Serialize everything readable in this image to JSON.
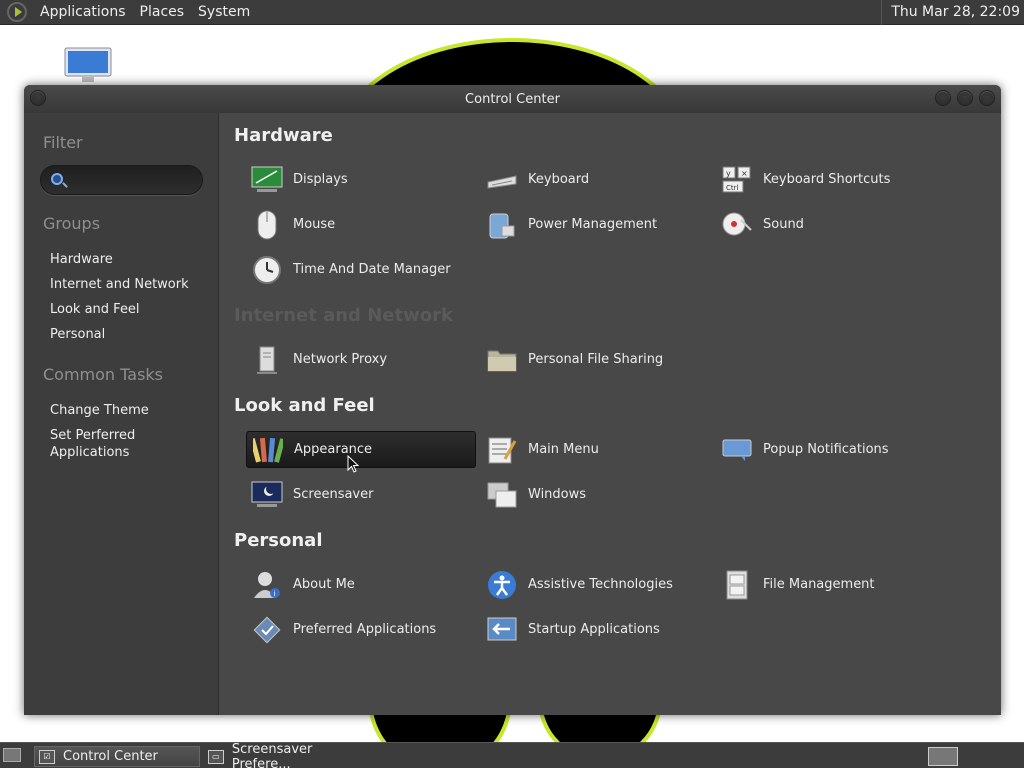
{
  "top_panel": {
    "menus": [
      "Applications",
      "Places",
      "System"
    ],
    "clock": "Thu Mar 28, 22:09"
  },
  "window": {
    "title": "Control Center"
  },
  "sidebar": {
    "filter_heading": "Filter",
    "search_placeholder": "",
    "groups_heading": "Groups",
    "groups": [
      "Hardware",
      "Internet and Network",
      "Look and Feel",
      "Personal"
    ],
    "tasks_heading": "Common Tasks",
    "tasks": [
      "Change Theme",
      "Set Perferred Applications"
    ]
  },
  "sections": [
    {
      "title": "Hardware",
      "items": [
        {
          "label": "Displays",
          "icon": "display-icon"
        },
        {
          "label": "Keyboard",
          "icon": "keyboard-icon"
        },
        {
          "label": "Keyboard Shortcuts",
          "icon": "keyboard-shortcuts-icon"
        },
        {
          "label": "Mouse",
          "icon": "mouse-icon"
        },
        {
          "label": "Power Management",
          "icon": "power-management-icon"
        },
        {
          "label": "Sound",
          "icon": "sound-icon"
        },
        {
          "label": "Time And Date Manager",
          "icon": "clock-icon"
        }
      ]
    },
    {
      "title": "Internet and Network",
      "items": [
        {
          "label": "Network Proxy",
          "icon": "network-proxy-icon"
        },
        {
          "label": "Personal File Sharing",
          "icon": "folder-share-icon"
        }
      ]
    },
    {
      "title": "Look and Feel",
      "items": [
        {
          "label": "Appearance",
          "icon": "appearance-icon",
          "selected": true
        },
        {
          "label": "Main Menu",
          "icon": "main-menu-icon"
        },
        {
          "label": "Popup Notifications",
          "icon": "notification-icon"
        },
        {
          "label": "Screensaver",
          "icon": "screensaver-icon"
        },
        {
          "label": "Windows",
          "icon": "windows-icon"
        }
      ]
    },
    {
      "title": "Personal",
      "items": [
        {
          "label": "About Me",
          "icon": "user-icon"
        },
        {
          "label": "Assistive Technologies",
          "icon": "accessibility-icon"
        },
        {
          "label": "File Management",
          "icon": "file-cabinet-icon"
        },
        {
          "label": "Preferred Applications",
          "icon": "preferred-apps-icon"
        },
        {
          "label": "Startup Applications",
          "icon": "startup-icon"
        }
      ]
    }
  ],
  "taskbar": {
    "tasks": [
      "Control Center",
      "Screensaver Prefere..."
    ]
  },
  "colors": {
    "accent": "#c8e62a",
    "window_bg": "#484848",
    "sidebar_bg": "#3d3d3d"
  }
}
